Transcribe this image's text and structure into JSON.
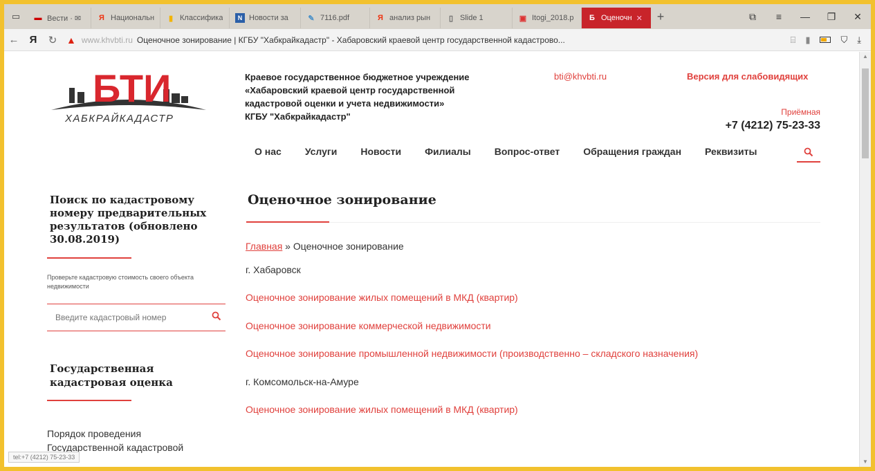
{
  "browser": {
    "tabs": [
      {
        "title": "Вести · ✉",
        "icon": "flag-icon"
      },
      {
        "title": "Национальн",
        "icon": "yandex-icon"
      },
      {
        "title": "Классифика",
        "icon": "note-icon"
      },
      {
        "title": "Новости за",
        "icon": "news-icon"
      },
      {
        "title": "7116.pdf",
        "icon": "file-icon"
      },
      {
        "title": "анализ рын",
        "icon": "yandex-icon"
      },
      {
        "title": "Slide 1",
        "icon": "doc-icon"
      },
      {
        "title": "Itogi_2018.p",
        "icon": "pdf-icon"
      },
      {
        "title": "Оценочн",
        "icon": "bti-icon",
        "active": true
      }
    ],
    "address_host": "www.khvbti.ru",
    "address_title": "Оценочное зонирование | КГБУ \"Хабкрайкадастр\" - Хабаровский краевой центр государственной кадастрово...",
    "status": "tel:+7 (4212) 75-23-33"
  },
  "header": {
    "logo_letters": "БТИ",
    "logo_subtitle": "ХАБКРАЙКАДАСТР",
    "org_lines": [
      "Краевое государственное бюджетное учреждение",
      "«Хабаровский краевой центр государственной",
      "кадастровой оценки и учета недвижимости»",
      "КГБУ \"Хабкрайкадастр\""
    ],
    "email": "bti@khvbti.ru",
    "accessibility": "Версия для слабовидящих",
    "reception_label": "Приёмная",
    "phone": "+7 (4212) 75-23-33"
  },
  "nav": [
    "О нас",
    "Услуги",
    "Новости",
    "Филиалы",
    "Вопрос-ответ",
    "Обращения граждан",
    "Реквизиты"
  ],
  "sidebar": {
    "search_heading": "Поиск по кадастровому номеру предварительных результатов (обновлено 30.08.2019)",
    "search_hint": "Проверьте кадастровую стоимость своего объекта недвижимости",
    "search_placeholder": "Введите кадастровый номер",
    "section_heading": "Государственная кадастровая оценка",
    "link": "Порядок проведения Государственной кадастровой"
  },
  "content": {
    "title": "Оценочное зонирование",
    "breadcrumb_home": "Главная",
    "breadcrumb_sep": " » ",
    "breadcrumb_current": "Оценочное зонирование",
    "city1": "г. Хабаровск",
    "links1": [
      "Оценочное зонирование жилых помещений в МКД (квартир)",
      "Оценочное зонирование коммерческой недвижимости",
      "Оценочное зонирование промышленной недвижимости (производственно – складского назначения)"
    ],
    "city2": "г. Комсомольск-на-Амуре",
    "links2": [
      "Оценочное зонирование жилых помещений в МКД (квартир)"
    ]
  },
  "colors": {
    "accent": "#e0403c",
    "active_tab": "#c8242a",
    "frame": "#f2c12e"
  }
}
